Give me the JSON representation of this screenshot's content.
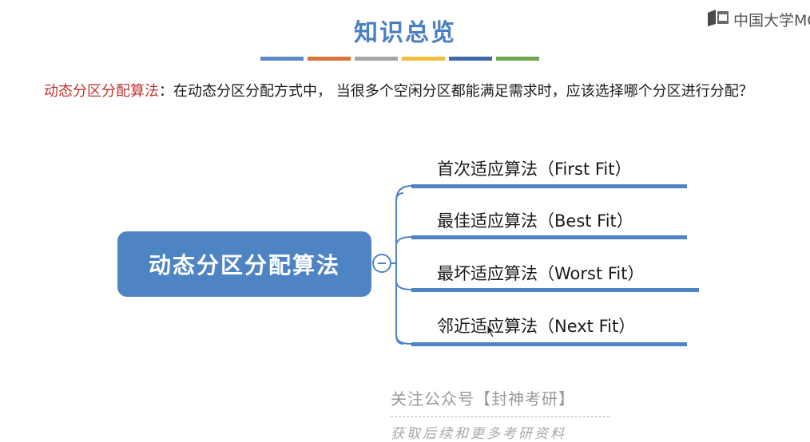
{
  "slide": {
    "title": "知识总览",
    "color_bars": [
      "#5b8ac5",
      "#d9733a",
      "#a6a6a6",
      "#f2bf3d",
      "#3e69a8",
      "#70a850"
    ]
  },
  "logo": {
    "text": "中国大学MO",
    "icon": "mooc-logo-icon"
  },
  "intro": {
    "term": "动态分区分配算法",
    "text": "：在动态分区分配方式中， 当很多个空闲分区都能满足需求时，应该选择哪个分区进行分配？"
  },
  "mindmap": {
    "root": "动态分区分配算法",
    "branches": [
      {
        "label": "首次适应算法（First Fit）"
      },
      {
        "label": "最佳适应算法（Best Fit）"
      },
      {
        "label": "最坏适应算法（Worst Fit）"
      },
      {
        "label": "邻近适应算法（Next Fit）"
      }
    ]
  },
  "watermark": {
    "line1": "关注公众号【封神考研】",
    "line2": "获取后续和更多考研资料"
  },
  "colors": {
    "title": "#4a80c1",
    "node": "#4f84c4",
    "term": "#c0322d"
  }
}
